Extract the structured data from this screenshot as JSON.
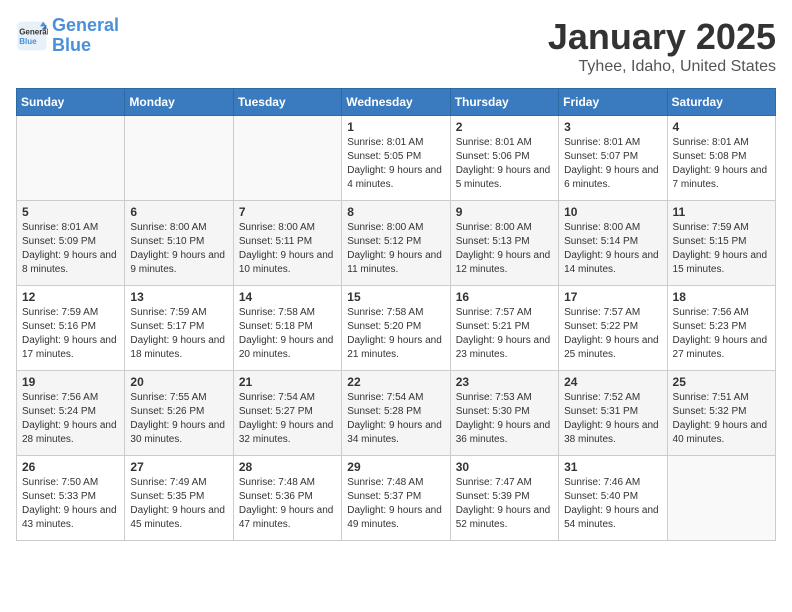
{
  "header": {
    "logo_line1": "General",
    "logo_line2": "Blue",
    "title": "January 2025",
    "subtitle": "Tyhee, Idaho, United States"
  },
  "days_of_week": [
    "Sunday",
    "Monday",
    "Tuesday",
    "Wednesday",
    "Thursday",
    "Friday",
    "Saturday"
  ],
  "weeks": [
    [
      {
        "day": "",
        "sunrise": "",
        "sunset": "",
        "daylight": ""
      },
      {
        "day": "",
        "sunrise": "",
        "sunset": "",
        "daylight": ""
      },
      {
        "day": "",
        "sunrise": "",
        "sunset": "",
        "daylight": ""
      },
      {
        "day": "1",
        "sunrise": "Sunrise: 8:01 AM",
        "sunset": "Sunset: 5:05 PM",
        "daylight": "Daylight: 9 hours and 4 minutes."
      },
      {
        "day": "2",
        "sunrise": "Sunrise: 8:01 AM",
        "sunset": "Sunset: 5:06 PM",
        "daylight": "Daylight: 9 hours and 5 minutes."
      },
      {
        "day": "3",
        "sunrise": "Sunrise: 8:01 AM",
        "sunset": "Sunset: 5:07 PM",
        "daylight": "Daylight: 9 hours and 6 minutes."
      },
      {
        "day": "4",
        "sunrise": "Sunrise: 8:01 AM",
        "sunset": "Sunset: 5:08 PM",
        "daylight": "Daylight: 9 hours and 7 minutes."
      }
    ],
    [
      {
        "day": "5",
        "sunrise": "Sunrise: 8:01 AM",
        "sunset": "Sunset: 5:09 PM",
        "daylight": "Daylight: 9 hours and 8 minutes."
      },
      {
        "day": "6",
        "sunrise": "Sunrise: 8:00 AM",
        "sunset": "Sunset: 5:10 PM",
        "daylight": "Daylight: 9 hours and 9 minutes."
      },
      {
        "day": "7",
        "sunrise": "Sunrise: 8:00 AM",
        "sunset": "Sunset: 5:11 PM",
        "daylight": "Daylight: 9 hours and 10 minutes."
      },
      {
        "day": "8",
        "sunrise": "Sunrise: 8:00 AM",
        "sunset": "Sunset: 5:12 PM",
        "daylight": "Daylight: 9 hours and 11 minutes."
      },
      {
        "day": "9",
        "sunrise": "Sunrise: 8:00 AM",
        "sunset": "Sunset: 5:13 PM",
        "daylight": "Daylight: 9 hours and 12 minutes."
      },
      {
        "day": "10",
        "sunrise": "Sunrise: 8:00 AM",
        "sunset": "Sunset: 5:14 PM",
        "daylight": "Daylight: 9 hours and 14 minutes."
      },
      {
        "day": "11",
        "sunrise": "Sunrise: 7:59 AM",
        "sunset": "Sunset: 5:15 PM",
        "daylight": "Daylight: 9 hours and 15 minutes."
      }
    ],
    [
      {
        "day": "12",
        "sunrise": "Sunrise: 7:59 AM",
        "sunset": "Sunset: 5:16 PM",
        "daylight": "Daylight: 9 hours and 17 minutes."
      },
      {
        "day": "13",
        "sunrise": "Sunrise: 7:59 AM",
        "sunset": "Sunset: 5:17 PM",
        "daylight": "Daylight: 9 hours and 18 minutes."
      },
      {
        "day": "14",
        "sunrise": "Sunrise: 7:58 AM",
        "sunset": "Sunset: 5:18 PM",
        "daylight": "Daylight: 9 hours and 20 minutes."
      },
      {
        "day": "15",
        "sunrise": "Sunrise: 7:58 AM",
        "sunset": "Sunset: 5:20 PM",
        "daylight": "Daylight: 9 hours and 21 minutes."
      },
      {
        "day": "16",
        "sunrise": "Sunrise: 7:57 AM",
        "sunset": "Sunset: 5:21 PM",
        "daylight": "Daylight: 9 hours and 23 minutes."
      },
      {
        "day": "17",
        "sunrise": "Sunrise: 7:57 AM",
        "sunset": "Sunset: 5:22 PM",
        "daylight": "Daylight: 9 hours and 25 minutes."
      },
      {
        "day": "18",
        "sunrise": "Sunrise: 7:56 AM",
        "sunset": "Sunset: 5:23 PM",
        "daylight": "Daylight: 9 hours and 27 minutes."
      }
    ],
    [
      {
        "day": "19",
        "sunrise": "Sunrise: 7:56 AM",
        "sunset": "Sunset: 5:24 PM",
        "daylight": "Daylight: 9 hours and 28 minutes."
      },
      {
        "day": "20",
        "sunrise": "Sunrise: 7:55 AM",
        "sunset": "Sunset: 5:26 PM",
        "daylight": "Daylight: 9 hours and 30 minutes."
      },
      {
        "day": "21",
        "sunrise": "Sunrise: 7:54 AM",
        "sunset": "Sunset: 5:27 PM",
        "daylight": "Daylight: 9 hours and 32 minutes."
      },
      {
        "day": "22",
        "sunrise": "Sunrise: 7:54 AM",
        "sunset": "Sunset: 5:28 PM",
        "daylight": "Daylight: 9 hours and 34 minutes."
      },
      {
        "day": "23",
        "sunrise": "Sunrise: 7:53 AM",
        "sunset": "Sunset: 5:30 PM",
        "daylight": "Daylight: 9 hours and 36 minutes."
      },
      {
        "day": "24",
        "sunrise": "Sunrise: 7:52 AM",
        "sunset": "Sunset: 5:31 PM",
        "daylight": "Daylight: 9 hours and 38 minutes."
      },
      {
        "day": "25",
        "sunrise": "Sunrise: 7:51 AM",
        "sunset": "Sunset: 5:32 PM",
        "daylight": "Daylight: 9 hours and 40 minutes."
      }
    ],
    [
      {
        "day": "26",
        "sunrise": "Sunrise: 7:50 AM",
        "sunset": "Sunset: 5:33 PM",
        "daylight": "Daylight: 9 hours and 43 minutes."
      },
      {
        "day": "27",
        "sunrise": "Sunrise: 7:49 AM",
        "sunset": "Sunset: 5:35 PM",
        "daylight": "Daylight: 9 hours and 45 minutes."
      },
      {
        "day": "28",
        "sunrise": "Sunrise: 7:48 AM",
        "sunset": "Sunset: 5:36 PM",
        "daylight": "Daylight: 9 hours and 47 minutes."
      },
      {
        "day": "29",
        "sunrise": "Sunrise: 7:48 AM",
        "sunset": "Sunset: 5:37 PM",
        "daylight": "Daylight: 9 hours and 49 minutes."
      },
      {
        "day": "30",
        "sunrise": "Sunrise: 7:47 AM",
        "sunset": "Sunset: 5:39 PM",
        "daylight": "Daylight: 9 hours and 52 minutes."
      },
      {
        "day": "31",
        "sunrise": "Sunrise: 7:46 AM",
        "sunset": "Sunset: 5:40 PM",
        "daylight": "Daylight: 9 hours and 54 minutes."
      },
      {
        "day": "",
        "sunrise": "",
        "sunset": "",
        "daylight": ""
      }
    ]
  ]
}
